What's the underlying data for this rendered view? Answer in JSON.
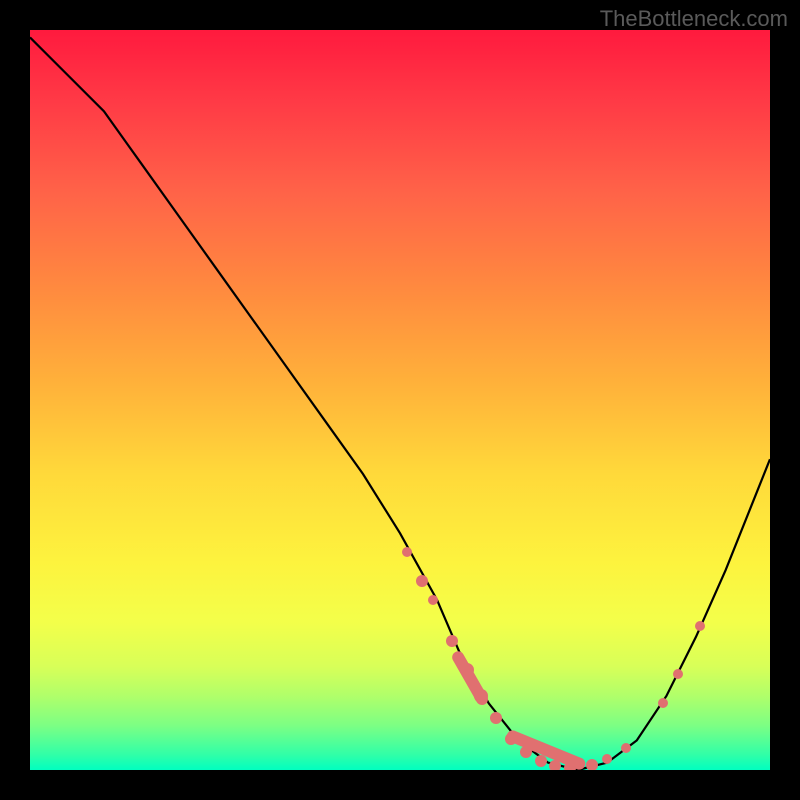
{
  "watermark": "TheBottleneck.com",
  "chart_data": {
    "type": "line",
    "title": "",
    "xlabel": "",
    "ylabel": "",
    "xlim": [
      0,
      100
    ],
    "ylim": [
      0,
      100
    ],
    "series": [
      {
        "name": "curve",
        "x": [
          0,
          5,
          10,
          15,
          20,
          25,
          30,
          35,
          40,
          45,
          50,
          55,
          58,
          62,
          66,
          70,
          74,
          78,
          82,
          86,
          90,
          94,
          98,
          100
        ],
        "y": [
          99,
          94,
          89,
          82,
          75,
          68,
          61,
          54,
          47,
          40,
          32,
          23,
          16,
          9,
          4,
          1,
          0,
          1,
          4,
          10,
          18,
          27,
          37,
          42
        ]
      }
    ],
    "highlight_dots": [
      {
        "x": 51.0,
        "y": 29.5,
        "r": 5
      },
      {
        "x": 53.0,
        "y": 25.5,
        "r": 6
      },
      {
        "x": 54.5,
        "y": 23.0,
        "r": 5
      },
      {
        "x": 57.0,
        "y": 17.5,
        "r": 6
      },
      {
        "x": 59.0,
        "y": 13.5,
        "r": 7
      },
      {
        "x": 61.0,
        "y": 10.0,
        "r": 7
      },
      {
        "x": 63.0,
        "y": 7.0,
        "r": 6
      },
      {
        "x": 65.0,
        "y": 4.2,
        "r": 6
      },
      {
        "x": 67.0,
        "y": 2.4,
        "r": 6
      },
      {
        "x": 69.0,
        "y": 1.2,
        "r": 6
      },
      {
        "x": 71.0,
        "y": 0.5,
        "r": 6
      },
      {
        "x": 73.0,
        "y": 0.3,
        "r": 6
      },
      {
        "x": 76.0,
        "y": 0.7,
        "r": 6
      },
      {
        "x": 78.0,
        "y": 1.5,
        "r": 5
      },
      {
        "x": 80.5,
        "y": 3.0,
        "r": 5
      },
      {
        "x": 85.5,
        "y": 9.0,
        "r": 5
      },
      {
        "x": 87.5,
        "y": 13.0,
        "r": 5
      },
      {
        "x": 90.5,
        "y": 19.5,
        "r": 5
      }
    ],
    "highlight_segments": [
      {
        "x1": 64.5,
        "y1": 4.8,
        "x2": 75.0,
        "y2": 0.5,
        "w": 12
      },
      {
        "x1": 57.5,
        "y1": 16.0,
        "x2": 61.5,
        "y2": 9.0,
        "w": 12
      }
    ]
  }
}
